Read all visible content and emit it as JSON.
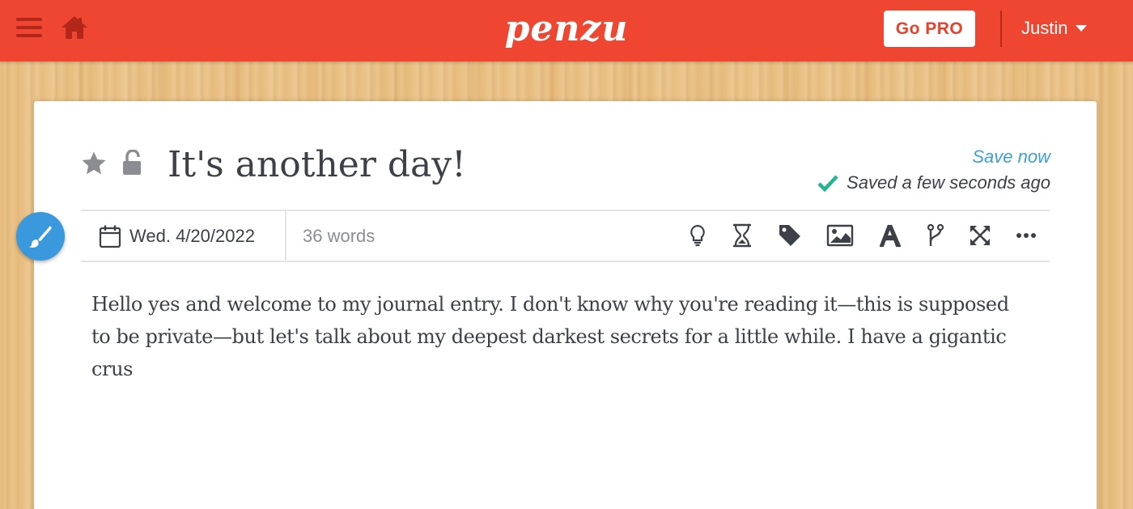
{
  "header": {
    "logo_text": "penzu",
    "go_pro_label": "Go PRO",
    "user_name": "Justin",
    "bar_color": "#ee4630"
  },
  "entry": {
    "title": "It's another day!",
    "save_now_label": "Save now",
    "saved_status": "Saved a few seconds ago",
    "date": "Wed. 4/20/2022",
    "word_count": "36 words",
    "body": "Hello yes and welcome to my journal entry. I don't know why you're reading it—this is supposed to be private—but let's talk about my deepest darkest secrets for a little while. I have a gigantic crus"
  },
  "toolbar_icons": [
    "lightbulb-icon",
    "hourglass-icon",
    "tag-icon",
    "image-icon",
    "font-icon",
    "branch-icon",
    "fullscreen-icon",
    "more-icon"
  ],
  "colors": {
    "accent_blue": "#3b9fd9",
    "check_green": "#1fb58f",
    "text_dark": "#3e4048"
  }
}
